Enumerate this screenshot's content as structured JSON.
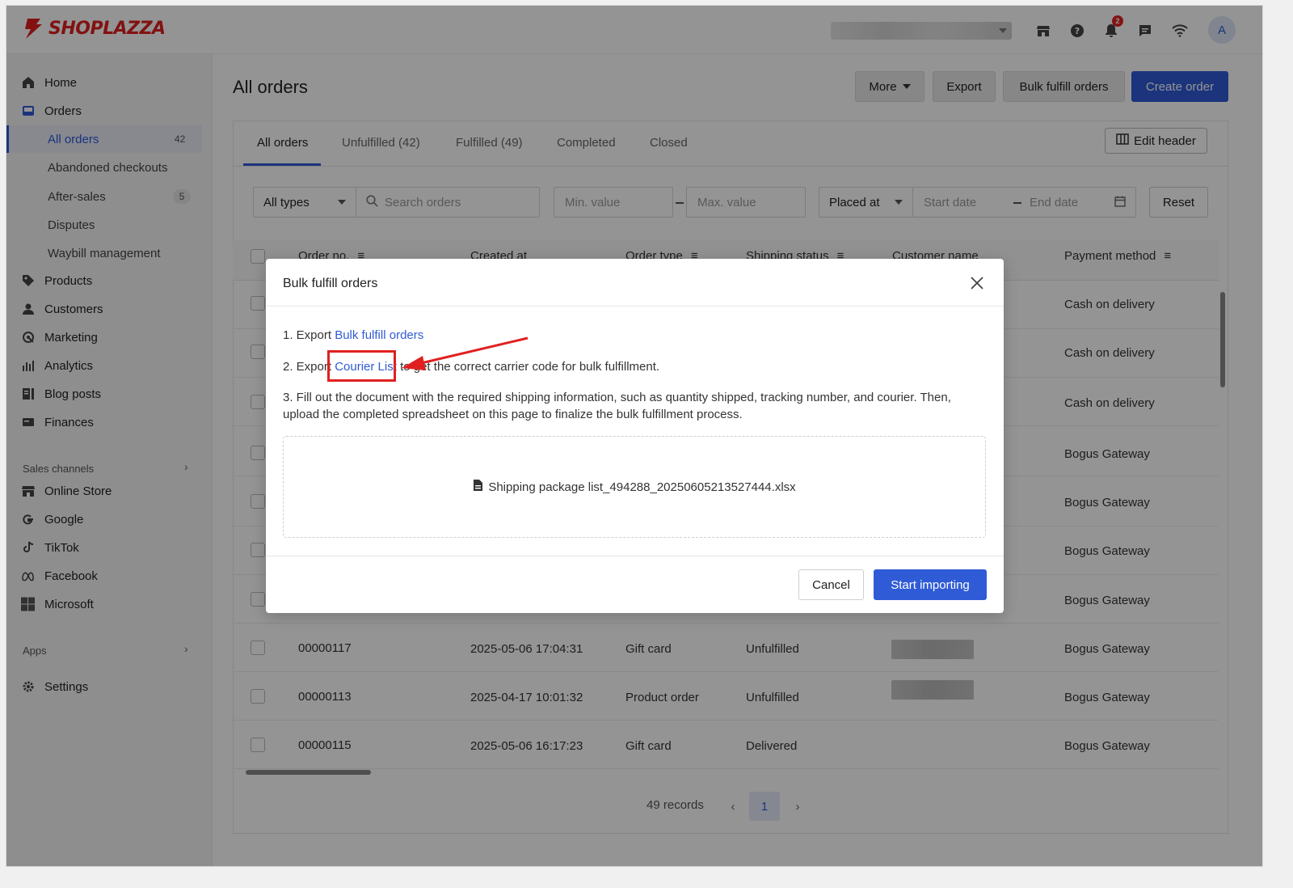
{
  "brand": {
    "logo_text": "SHOPLAZZA",
    "accent": "#2f5bd6",
    "logo_color": "#e02020"
  },
  "topbar": {
    "notification_count": "2",
    "avatar_initial": "A"
  },
  "sidebar": {
    "home": "Home",
    "orders": "Orders",
    "order_subitems": [
      {
        "label": "All orders",
        "count": "42"
      },
      {
        "label": "Abandoned checkouts"
      },
      {
        "label": "After-sales",
        "count": "5"
      },
      {
        "label": "Disputes"
      },
      {
        "label": "Waybill management"
      }
    ],
    "products": "Products",
    "customers": "Customers",
    "marketing": "Marketing",
    "analytics": "Analytics",
    "blog_posts": "Blog posts",
    "finances": "Finances",
    "sales_channels_label": "Sales channels",
    "channels": [
      "Online Store",
      "Google",
      "TikTok",
      "Facebook",
      "Microsoft"
    ],
    "apps_label": "Apps",
    "settings": "Settings"
  },
  "header": {
    "title": "All orders",
    "more": "More",
    "export": "Export",
    "bulk_fulfill": "Bulk fulfill orders",
    "create_order": "Create order"
  },
  "tabs": [
    "All orders",
    "Unfulfilled  (42)",
    "Fulfilled  (49)",
    "Completed",
    "Closed"
  ],
  "edit_header": "Edit header",
  "filters": {
    "type": "All types",
    "search_placeholder": "Search orders",
    "min_placeholder": "Min. value",
    "max_placeholder": "Max. value",
    "date_field": "Placed at",
    "start_placeholder": "Start date",
    "end_placeholder": "End date",
    "reset": "Reset"
  },
  "table": {
    "columns": [
      "Order no.",
      "Created at",
      "Order type",
      "Shipping status",
      "Customer name",
      "Payment method"
    ],
    "rows": [
      {
        "payment": "Cash on delivery"
      },
      {
        "payment": "Cash on delivery"
      },
      {
        "payment": "Cash on delivery"
      },
      {
        "payment": "Bogus Gateway"
      },
      {
        "payment": "Bogus Gateway"
      },
      {
        "payment": "Bogus Gateway"
      },
      {
        "payment": "Bogus Gateway"
      },
      {
        "order_no": "00000117",
        "created": "2025-05-06 17:04:31",
        "type": "Gift card",
        "status": "Unfulfilled",
        "payment": "Bogus Gateway"
      },
      {
        "order_no": "00000113",
        "created": "2025-04-17 10:01:32",
        "type": "Product order",
        "status": "Unfulfilled",
        "payment": "Bogus Gateway"
      },
      {
        "order_no": "00000115",
        "created": "2025-05-06 16:17:23",
        "type": "Gift card",
        "status": "Delivered",
        "payment": "Bogus Gateway"
      }
    ]
  },
  "pagination": {
    "records": "49 records",
    "page": "1"
  },
  "modal": {
    "title": "Bulk fulfill orders",
    "step1_prefix": "1. Export ",
    "step1_link": "Bulk fulfill orders",
    "step2_prefix": "2. Export ",
    "step2_link": "Courier List",
    "step2_suffix": " to get the correct carrier code for bulk fulfillment.",
    "step3_line1": "3. Fill out the document with the required shipping information, such as quantity shipped, tracking number, and courier. Then,",
    "step3_line2": "upload the completed spreadsheet on this page to finalize the bulk fulfillment process.",
    "file_name": "Shipping package list_494288_20250605213527444.xlsx",
    "cancel": "Cancel",
    "start": "Start importing"
  }
}
